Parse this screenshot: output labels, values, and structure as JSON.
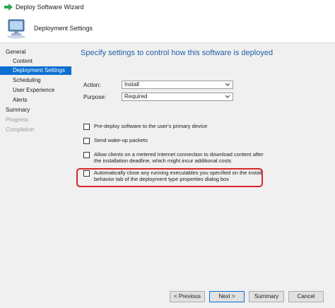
{
  "window": {
    "title": "Deploy Software Wizard"
  },
  "header": {
    "title": "Deployment Settings"
  },
  "sidebar": {
    "items": [
      {
        "label": "General",
        "state": "normal"
      },
      {
        "label": "Content",
        "state": "normal"
      },
      {
        "label": "Deployment Settings",
        "state": "active"
      },
      {
        "label": "Scheduling",
        "state": "normal"
      },
      {
        "label": "User Experience",
        "state": "normal"
      },
      {
        "label": "Alerts",
        "state": "normal"
      },
      {
        "label": "Summary",
        "state": "normal"
      },
      {
        "label": "Progress",
        "state": "disabled"
      },
      {
        "label": "Completion",
        "state": "disabled"
      }
    ]
  },
  "main": {
    "heading": "Specify settings to control how this software is deployed",
    "action": {
      "label": "Action:",
      "value": "Install"
    },
    "purpose": {
      "label": "Purpose:",
      "value": "Required"
    },
    "options": [
      {
        "label": "Pre-deploy software to the user's primary device",
        "checked": false
      },
      {
        "label": "Send wake-up packets",
        "checked": false
      },
      {
        "label": "Allow clients on a metered Internet connection to download content after the installation deadline, which might incur additional costs",
        "checked": false
      },
      {
        "label": "Automatically close any running executables you specified on the install behavior tab of the deployment type properties dialog box",
        "checked": false
      }
    ]
  },
  "footer": {
    "previous_label": "< Previous",
    "next_label": "Next >",
    "summary_label": "Summary",
    "cancel_label": "Cancel"
  },
  "colors": {
    "accent": "#0a6fd1",
    "heading": "#1f5fa8",
    "highlight": "#d9252a",
    "title_arrow": "#2aa84a"
  },
  "icons": {
    "title": "green-arrow-icon",
    "header": "computer-icon",
    "dropdown": "chevron-down-icon"
  }
}
